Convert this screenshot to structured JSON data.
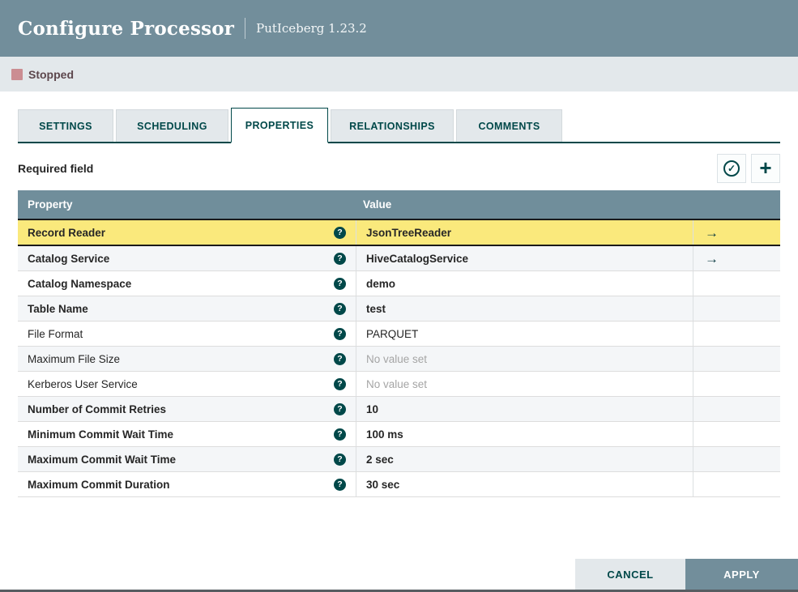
{
  "window": {
    "title": "Configure Processor",
    "subtitle": "PutIceberg 1.23.2"
  },
  "status": {
    "label": "Stopped",
    "color": "#cb8d92"
  },
  "tabs": [
    {
      "label": "SETTINGS",
      "active": false
    },
    {
      "label": "SCHEDULING",
      "active": false
    },
    {
      "label": "PROPERTIES",
      "active": true
    },
    {
      "label": "RELATIONSHIPS",
      "active": false
    },
    {
      "label": "COMMENTS",
      "active": false
    }
  ],
  "toolbar": {
    "required_label": "Required field",
    "verify_icon": "✓",
    "add_icon": "+"
  },
  "table": {
    "columns": {
      "property": "Property",
      "value": "Value"
    },
    "help_icon": "?",
    "goto_icon": "→",
    "rows": [
      {
        "property": "Record Reader",
        "value": "JsonTreeReader",
        "selected": true,
        "bold": true,
        "has_arrow": true,
        "placeholder": false
      },
      {
        "property": "Catalog Service",
        "value": "HiveCatalogService",
        "selected": false,
        "bold": true,
        "has_arrow": true,
        "placeholder": false
      },
      {
        "property": "Catalog Namespace",
        "value": "demo",
        "selected": false,
        "bold": true,
        "has_arrow": false,
        "placeholder": false
      },
      {
        "property": "Table Name",
        "value": "test",
        "selected": false,
        "bold": true,
        "has_arrow": false,
        "placeholder": false
      },
      {
        "property": "File Format",
        "value": "PARQUET",
        "selected": false,
        "bold": false,
        "has_arrow": false,
        "placeholder": false
      },
      {
        "property": "Maximum File Size",
        "value": "No value set",
        "selected": false,
        "bold": false,
        "has_arrow": false,
        "placeholder": true
      },
      {
        "property": "Kerberos User Service",
        "value": "No value set",
        "selected": false,
        "bold": false,
        "has_arrow": false,
        "placeholder": true
      },
      {
        "property": "Number of Commit Retries",
        "value": "10",
        "selected": false,
        "bold": true,
        "has_arrow": false,
        "placeholder": false
      },
      {
        "property": "Minimum Commit Wait Time",
        "value": "100 ms",
        "selected": false,
        "bold": true,
        "has_arrow": false,
        "placeholder": false
      },
      {
        "property": "Maximum Commit Wait Time",
        "value": "2 sec",
        "selected": false,
        "bold": true,
        "has_arrow": false,
        "placeholder": false
      },
      {
        "property": "Maximum Commit Duration",
        "value": "30 sec",
        "selected": false,
        "bold": true,
        "has_arrow": false,
        "placeholder": false
      }
    ]
  },
  "footer": {
    "cancel_label": "CANCEL",
    "apply_label": "APPLY"
  },
  "colors": {
    "header_slate": "#728e9b",
    "accent_teal": "#004849",
    "status_bar_bg": "#e3e8eb",
    "stopped_square": "#cb8d92",
    "stopped_text": "#5d474d",
    "selected_row_yellow": "#fae97c",
    "alt_row_bg": "#f4f6f8",
    "table_header_bg": "#708e9b"
  }
}
